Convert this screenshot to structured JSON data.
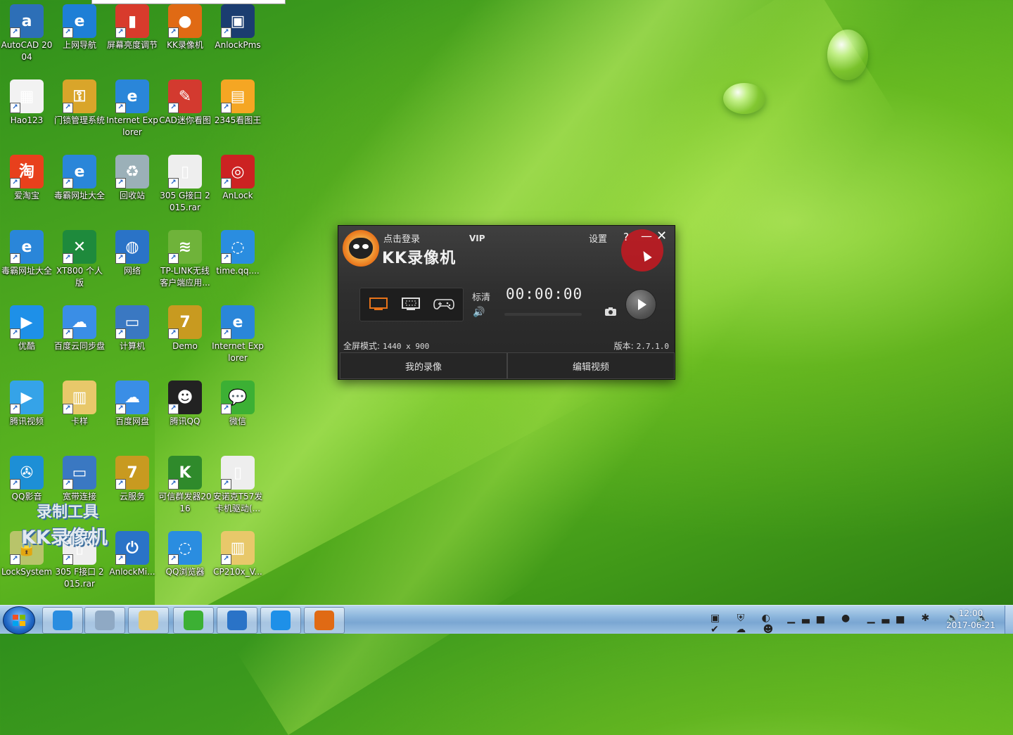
{
  "desktop": {
    "icons": [
      {
        "label": "AutoCAD 2004",
        "glyph": "a",
        "color": "#2d6fb7"
      },
      {
        "label": "上网导航",
        "glyph": "e",
        "color": "#1e7fd6"
      },
      {
        "label": "屏幕亮度调节",
        "glyph": "▮",
        "color": "#d83b2c"
      },
      {
        "label": "KK录像机",
        "glyph": "●",
        "color": "#e06a14"
      },
      {
        "label": "AnlockPms",
        "glyph": "▣",
        "color": "#1b3d70"
      },
      {
        "label": "Hao123",
        "glyph": "▦",
        "color": "#f2f2f2"
      },
      {
        "label": "门锁管理系统",
        "glyph": "⚿",
        "color": "#d9a52a"
      },
      {
        "label": "Internet Explorer",
        "glyph": "e",
        "color": "#2a86d9"
      },
      {
        "label": "CAD迷你看图",
        "glyph": "✎",
        "color": "#d33a2f"
      },
      {
        "label": "2345看图王",
        "glyph": "▤",
        "color": "#f5a623"
      },
      {
        "label": "爱淘宝",
        "glyph": "淘",
        "color": "#e8401c"
      },
      {
        "label": "毒霸网址大全",
        "glyph": "e",
        "color": "#2a86d9"
      },
      {
        "label": "回收站",
        "glyph": "♻",
        "color": "#9bb0b8"
      },
      {
        "label": "305 G接口 2015.rar",
        "glyph": "▯",
        "color": "#eeeeee"
      },
      {
        "label": "AnLock",
        "glyph": "◎",
        "color": "#cc2222"
      },
      {
        "label": "毒霸网址大全",
        "glyph": "e",
        "color": "#2a86d9"
      },
      {
        "label": "XT800 个人版",
        "glyph": "✕",
        "color": "#1e8a3c"
      },
      {
        "label": "网络",
        "glyph": "◍",
        "color": "#2a73c7"
      },
      {
        "label": "TP-LINK无线客户端应用...",
        "glyph": "≋",
        "color": "#6fb33a"
      },
      {
        "label": "time.qq....",
        "glyph": "◌",
        "color": "#2a8de0"
      },
      {
        "label": "优酷",
        "glyph": "▶",
        "color": "#1e90e8"
      },
      {
        "label": "百度云同步盘",
        "glyph": "☁",
        "color": "#3a8ee6"
      },
      {
        "label": "计算机",
        "glyph": "▭",
        "color": "#3a78c2"
      },
      {
        "label": "Demo",
        "glyph": "7",
        "color": "#c89a20"
      },
      {
        "label": "Internet Explorer",
        "glyph": "e",
        "color": "#2a86d9"
      },
      {
        "label": "腾讯视频",
        "glyph": "▶",
        "color": "#35a3e8"
      },
      {
        "label": "卡样",
        "glyph": "▥",
        "color": "#e8c86a"
      },
      {
        "label": "百度网盘",
        "glyph": "☁",
        "color": "#3a8ee6"
      },
      {
        "label": "腾讯QQ",
        "glyph": "☻",
        "color": "#222222"
      },
      {
        "label": "微信",
        "glyph": "💬",
        "color": "#3cb034"
      },
      {
        "label": "QQ影音",
        "glyph": "✇",
        "color": "#1d8fd6"
      },
      {
        "label": "宽带连接",
        "glyph": "▭",
        "color": "#3a78c2"
      },
      {
        "label": "云服务",
        "glyph": "7",
        "color": "#c89a20"
      },
      {
        "label": "可信群发器2016",
        "glyph": "K",
        "color": "#2f8a2b"
      },
      {
        "label": "安诺克T57发卡机驱动(...",
        "glyph": "▯",
        "color": "#eeeeee"
      },
      {
        "label": "LockSystem",
        "glyph": "🔒",
        "color": "#b8c46a"
      },
      {
        "label": "305 F接口 2015.rar",
        "glyph": "▯",
        "color": "#eeeeee"
      },
      {
        "label": "AnlockMi...",
        "glyph": "⏻",
        "color": "#2a73c7"
      },
      {
        "label": "QQ浏览器",
        "glyph": "◌",
        "color": "#2a8de0"
      },
      {
        "label": "CP210x_V...",
        "glyph": "▥",
        "color": "#e8c86a"
      }
    ],
    "watermark": {
      "line1": "录制工具",
      "line2": "KK录像机"
    }
  },
  "kk_window": {
    "login": "点击登录",
    "vip": "VIP",
    "title": "KK录像机",
    "settings": "设置",
    "help": "?",
    "minimize": "—",
    "close": "✕",
    "quality": "标清",
    "timer": "00:00:00",
    "mode_label": "全屏模式:",
    "mode_value": "1440 x 900",
    "version_label": "版本:",
    "version_value": "2.7.1.0",
    "btn_my_videos": "我的录像",
    "btn_edit_video": "编辑视频",
    "accent": "#e8731a"
  },
  "taskbar": {
    "items": [
      {
        "name": "qq-browser",
        "color": "#2a8de0"
      },
      {
        "name": "explorer-window",
        "color": "#8fa9c4"
      },
      {
        "name": "file-explorer",
        "color": "#e8c86a"
      },
      {
        "name": "wechat",
        "color": "#3cb034"
      },
      {
        "name": "anlock",
        "color": "#2a73c7"
      },
      {
        "name": "youku",
        "color": "#1e90e8"
      },
      {
        "name": "kk-recorder",
        "color": "#e06a14"
      }
    ],
    "time": "12:00",
    "date": "2017-06-21"
  }
}
